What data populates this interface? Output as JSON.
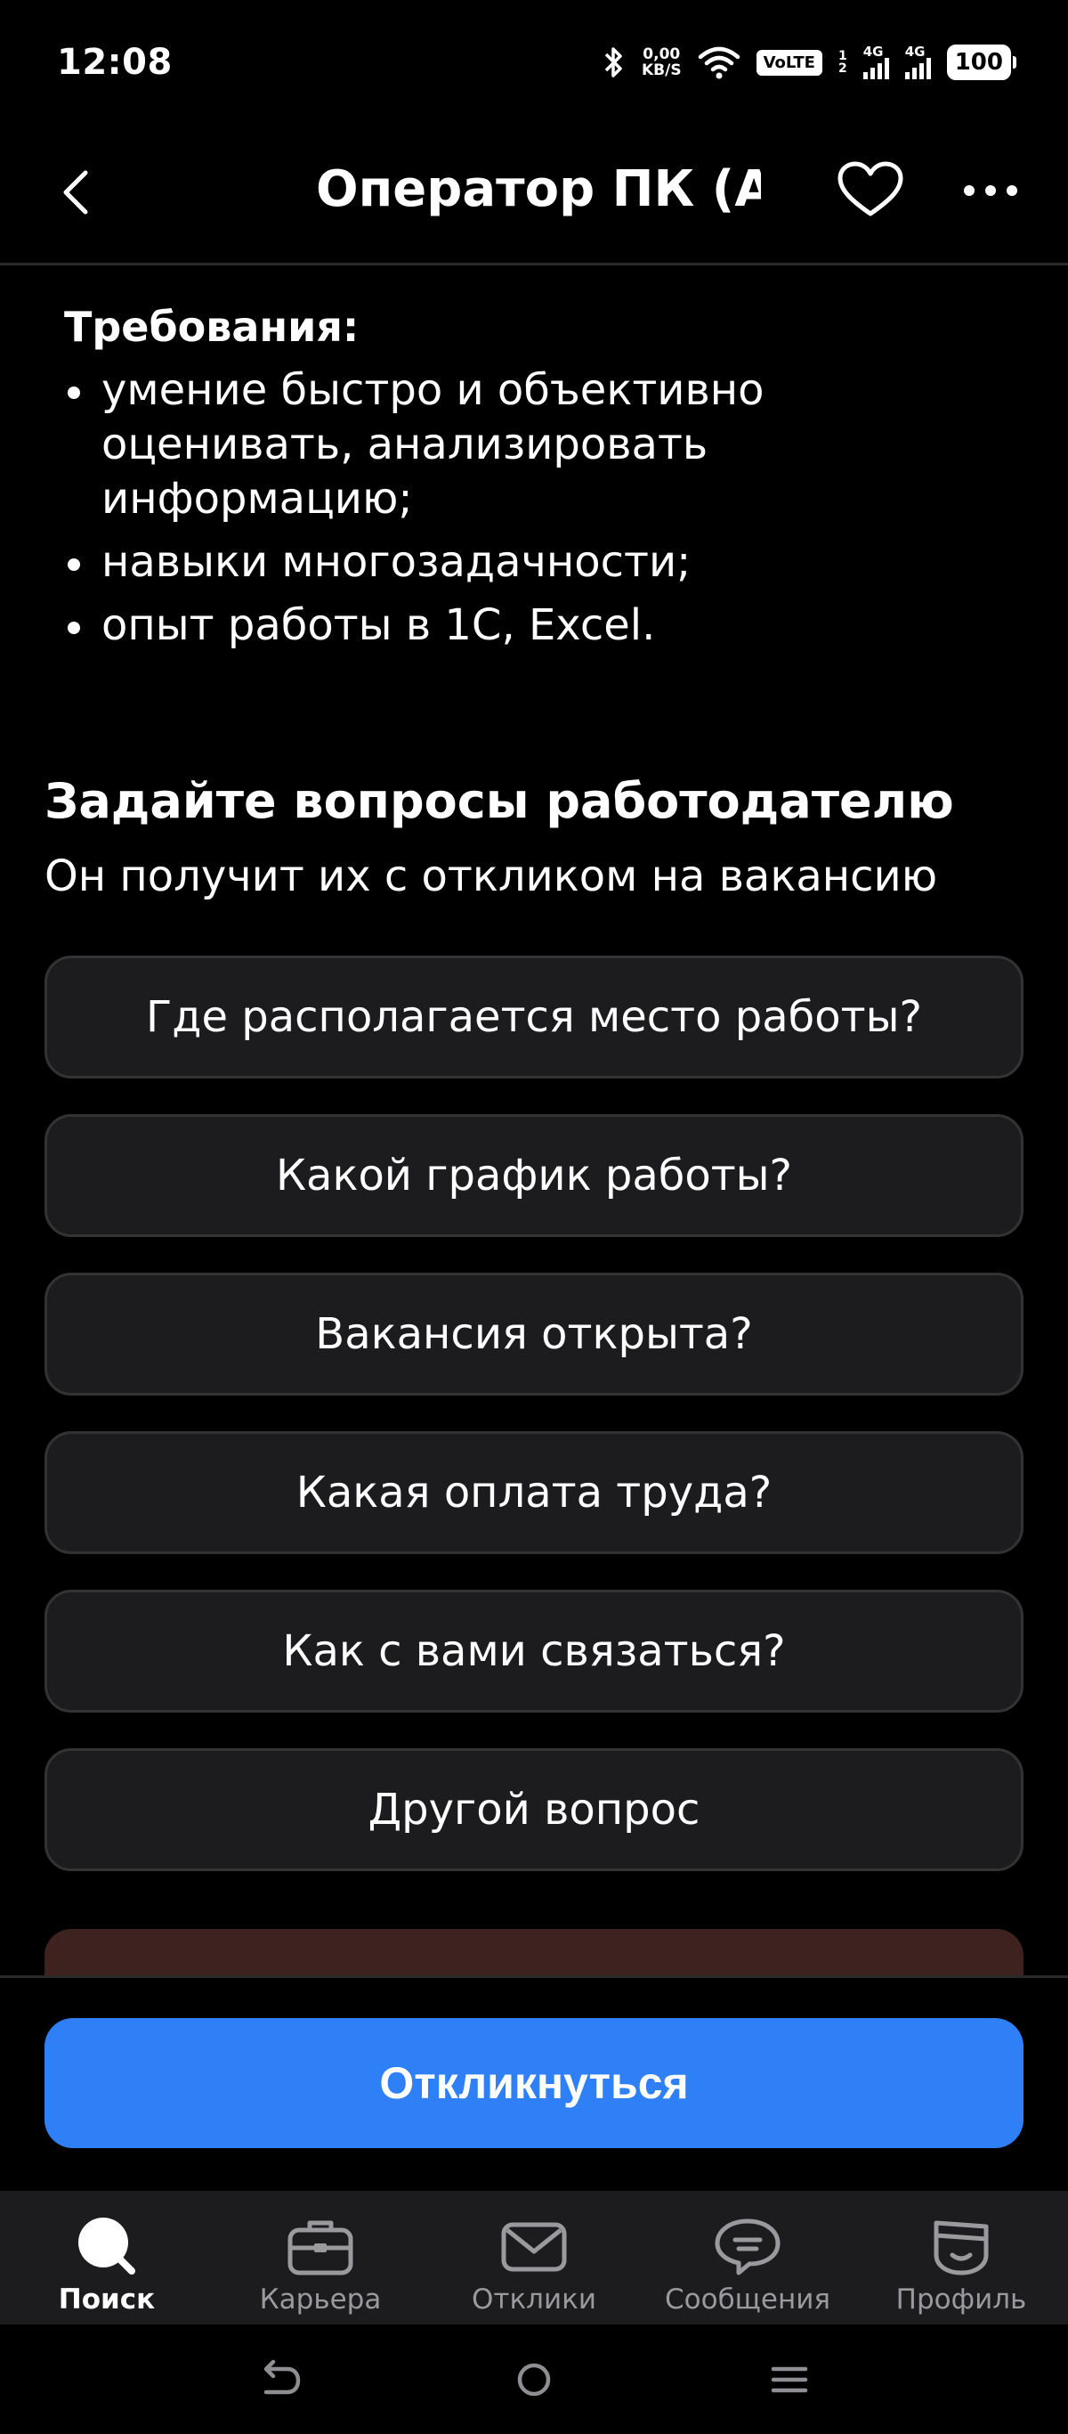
{
  "status_bar": {
    "time": "12:08",
    "net_speed_value": "0,00",
    "net_speed_unit": "KB/S",
    "volte": "VoLTE",
    "sim1": "1",
    "sim2": "2",
    "net1": "4G",
    "net2": "4G",
    "battery": "100"
  },
  "app_bar": {
    "title": "Оператор ПК (А..."
  },
  "requirements": {
    "heading": "Требования:",
    "items": [
      "умение быстро и объективно оценивать, анализировать информацию;",
      "навыки многозадачности;",
      "опыт работы в 1С, Excel."
    ]
  },
  "ask": {
    "title": "Задайте вопросы работодателю",
    "subtitle": "Он получит их с откликом на вакансию",
    "questions": [
      "Где располагается место работы?",
      "Какой график работы?",
      "Вакансия открыта?",
      "Какая оплата труда?",
      "Как с вами связаться?",
      "Другой вопрос"
    ]
  },
  "respond_button": "Откликнуться",
  "tabs": [
    {
      "label": "Поиск",
      "icon": "search-icon",
      "active": true
    },
    {
      "label": "Карьера",
      "icon": "briefcase-icon",
      "active": false
    },
    {
      "label": "Отклики",
      "icon": "envelope-icon",
      "active": false
    },
    {
      "label": "Сообщения",
      "icon": "chat-bubble-icon",
      "active": false
    },
    {
      "label": "Профиль",
      "icon": "profile-icon",
      "active": false
    }
  ],
  "colors": {
    "background": "#000000",
    "card": "#1c1c1e",
    "accent": "#2f7ff7",
    "peek_card": "#3d2220"
  }
}
